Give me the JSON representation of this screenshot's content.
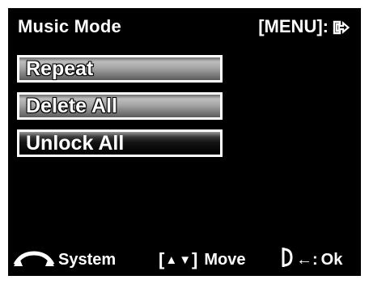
{
  "header": {
    "title": "Music Mode",
    "menu_hint": "[MENU]:",
    "exit_icon": "exit-arrow-icon"
  },
  "menu": {
    "items": [
      {
        "label": "Repeat",
        "state": "unselected"
      },
      {
        "label": "Delete All",
        "state": "unselected"
      },
      {
        "label": "Unlock All",
        "state": "selected"
      }
    ]
  },
  "footer": {
    "system_label": "System",
    "move_label": "Move",
    "ok_label": "Ok",
    "bracket_open": "[",
    "bracket_close": "]",
    "up_glyph": "▲",
    "down_glyph": "▼",
    "ok_arrow": "←:",
    "system_icon": "mode-dial-icon",
    "ok_icon": "shutter-half-press-icon"
  },
  "colors": {
    "screen_bg": "#000000",
    "text": "#ffffff",
    "item_unselected_gradient_mid": "#a7a7a7",
    "item_selected_gradient_mid": "#141414",
    "item_border": "#ffffff"
  }
}
